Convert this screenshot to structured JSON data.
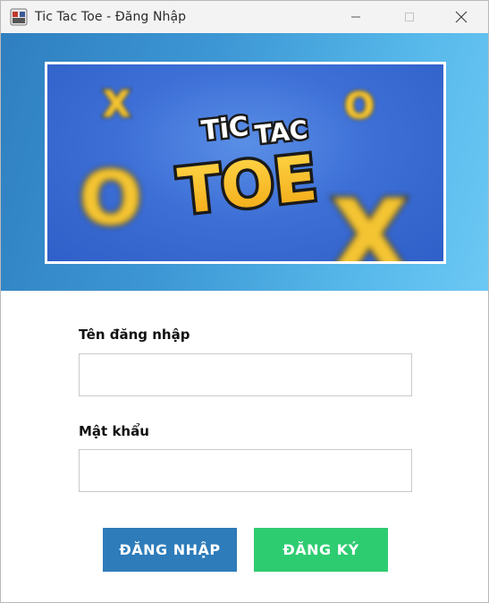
{
  "window": {
    "title": "Tic Tac Toe - Đăng Nhập"
  },
  "titlebar_icons": {
    "app": "app-icon",
    "minimize": "minimize-icon",
    "maximize": "maximize-icon",
    "close": "close-icon"
  },
  "banner": {
    "logo_line1": "TiC",
    "logo_line2": "TAC",
    "logo_line3": "TOE",
    "marks": [
      "X",
      "O",
      "O",
      "X"
    ]
  },
  "form": {
    "username_label": "Tên đăng nhập",
    "username_value": "",
    "password_label": "Mật khẩu",
    "password_value": ""
  },
  "buttons": {
    "login_label": "ĐĂNG NHẬP",
    "register_label": "ĐĂNG KÝ"
  },
  "colors": {
    "login_button": "#2e7cba",
    "register_button": "#2ecc71",
    "banner_gradient_start": "#2f7fc0",
    "banner_gradient_end": "#6cc8f4"
  }
}
